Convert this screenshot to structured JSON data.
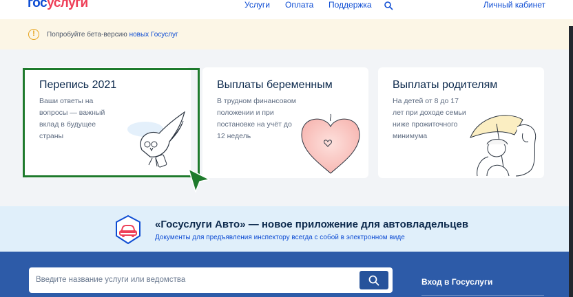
{
  "header": {
    "logo_part1": "гос",
    "logo_part2": "услуги",
    "nav": [
      {
        "label": "Услуги"
      },
      {
        "label": "Оплата"
      },
      {
        "label": "Поддержка"
      }
    ],
    "search_icon": "search-icon",
    "cabinet": "Личный кабинет"
  },
  "beta": {
    "icon": "!",
    "text": "Попробуйте бета-версию ",
    "link": "новых Госуслуг"
  },
  "cards": [
    {
      "title": "Перепись 2021",
      "desc": "Ваши ответы на вопросы — важный вклад в будущее страны",
      "icon": "census-owl-illustration"
    },
    {
      "title": "Выплаты беременным",
      "desc": "В трудном финансовом положении и при постановке на учёт до 12 недель",
      "icon": "heart-illustration"
    },
    {
      "title": "Выплаты родителям",
      "desc": "На детей от 8 до 17 лет при доходе семьи ниже прожиточного минимума",
      "icon": "family-umbrella-illustration"
    }
  ],
  "auto_banner": {
    "title": "«Госуслуги Авто» — новое приложение для автовладельцев",
    "subtitle": "Документы для предъявления инспектору всегда с собой в электронном виде",
    "icon": "car-icon"
  },
  "search": {
    "placeholder": "Введите название услуги или ведомства",
    "value": ""
  },
  "login": {
    "label": "Вход в Госуслуги"
  },
  "colors": {
    "brand_blue": "#0d4cd3",
    "brand_red": "#ee3f58",
    "band_blue": "#2d5ba8",
    "highlight_green": "#1e7a2c"
  }
}
